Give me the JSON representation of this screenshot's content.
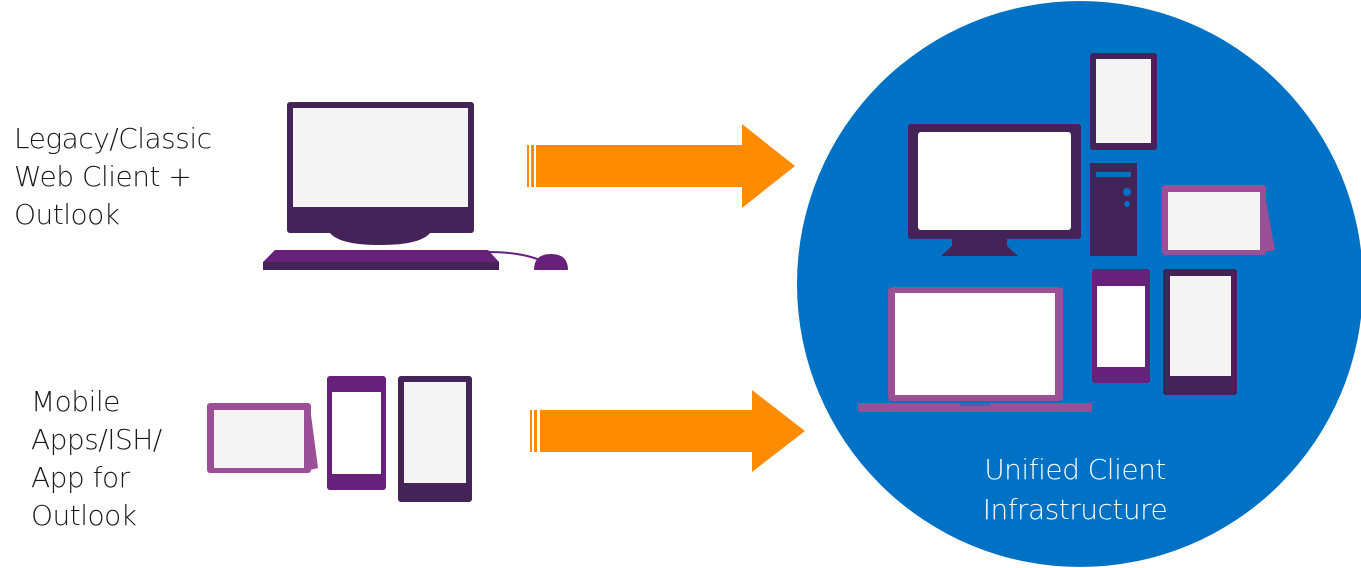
{
  "diagram": {
    "type": "migration-flow",
    "sources": [
      {
        "id": "legacy",
        "label_lines": [
          "Legacy/Classic",
          "Web Client +",
          "Outlook"
        ],
        "icon": "desktop-computer-icon"
      },
      {
        "id": "mobile",
        "label_lines": [
          "Mobile",
          "Apps/ISH/",
          "App for",
          "Outlook"
        ],
        "icon": "mobile-devices-icon"
      }
    ],
    "target": {
      "label_lines": [
        "Unified Client",
        "Infrastructure"
      ],
      "icon": "all-devices-icon"
    },
    "arrows": [
      {
        "from": "legacy",
        "to": "target",
        "icon": "arrow-right-icon"
      },
      {
        "from": "mobile",
        "to": "target",
        "icon": "arrow-right-icon"
      }
    ]
  },
  "colors": {
    "arrow": "#FF8C00",
    "circle": "#0072C6",
    "dark_purple": "#442359",
    "mid_purple": "#68217A",
    "light_purple": "#9B4F96",
    "screen": "#F4F4F4",
    "text": "#1a1a1a"
  }
}
